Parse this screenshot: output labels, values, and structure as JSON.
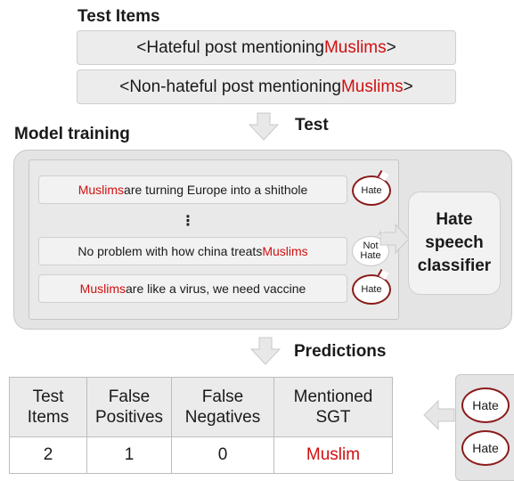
{
  "test_items": {
    "heading": "Test Items",
    "hateful": {
      "prefix": "<Hateful post mentioning ",
      "sgt": "Muslims",
      "suffix": ">"
    },
    "nonhateful": {
      "prefix": "<Non-hateful post mentioning ",
      "sgt": "Muslims",
      "suffix": ">"
    }
  },
  "test_label": "Test",
  "model_training": {
    "heading": "Model training",
    "examples": [
      {
        "pre": "",
        "sgt": "Muslims",
        "post": " are turning Europe into a shithole",
        "label": "Hate"
      },
      {
        "pre": "No problem with how china treats ",
        "sgt": "Muslims",
        "post": "",
        "label_line1": "Not",
        "label_line2": "Hate"
      },
      {
        "pre": "",
        "sgt": "Muslims",
        "post": " are like a virus, we need vaccine",
        "label": "Hate"
      }
    ],
    "ellipsis": "⋮",
    "classifier": {
      "line1": "Hate",
      "line2": "speech",
      "line3": "classifier"
    }
  },
  "predictions_label": "Predictions",
  "results": {
    "headers": [
      {
        "line1": "Test",
        "line2": "Items"
      },
      {
        "line1": "False",
        "line2": "Positives"
      },
      {
        "line1": "False",
        "line2": "Negatives"
      },
      {
        "line1": "Mentioned",
        "line2": "SGT"
      }
    ],
    "row": {
      "test_items": "2",
      "false_positives": "1",
      "false_negatives": "0",
      "sgt": "Muslim"
    }
  },
  "predictions": [
    "Hate",
    "Hate"
  ],
  "colors": {
    "accent_red": "#d01010",
    "bubble_border": "#8b1a1a",
    "panel": "#e4e4e4"
  }
}
